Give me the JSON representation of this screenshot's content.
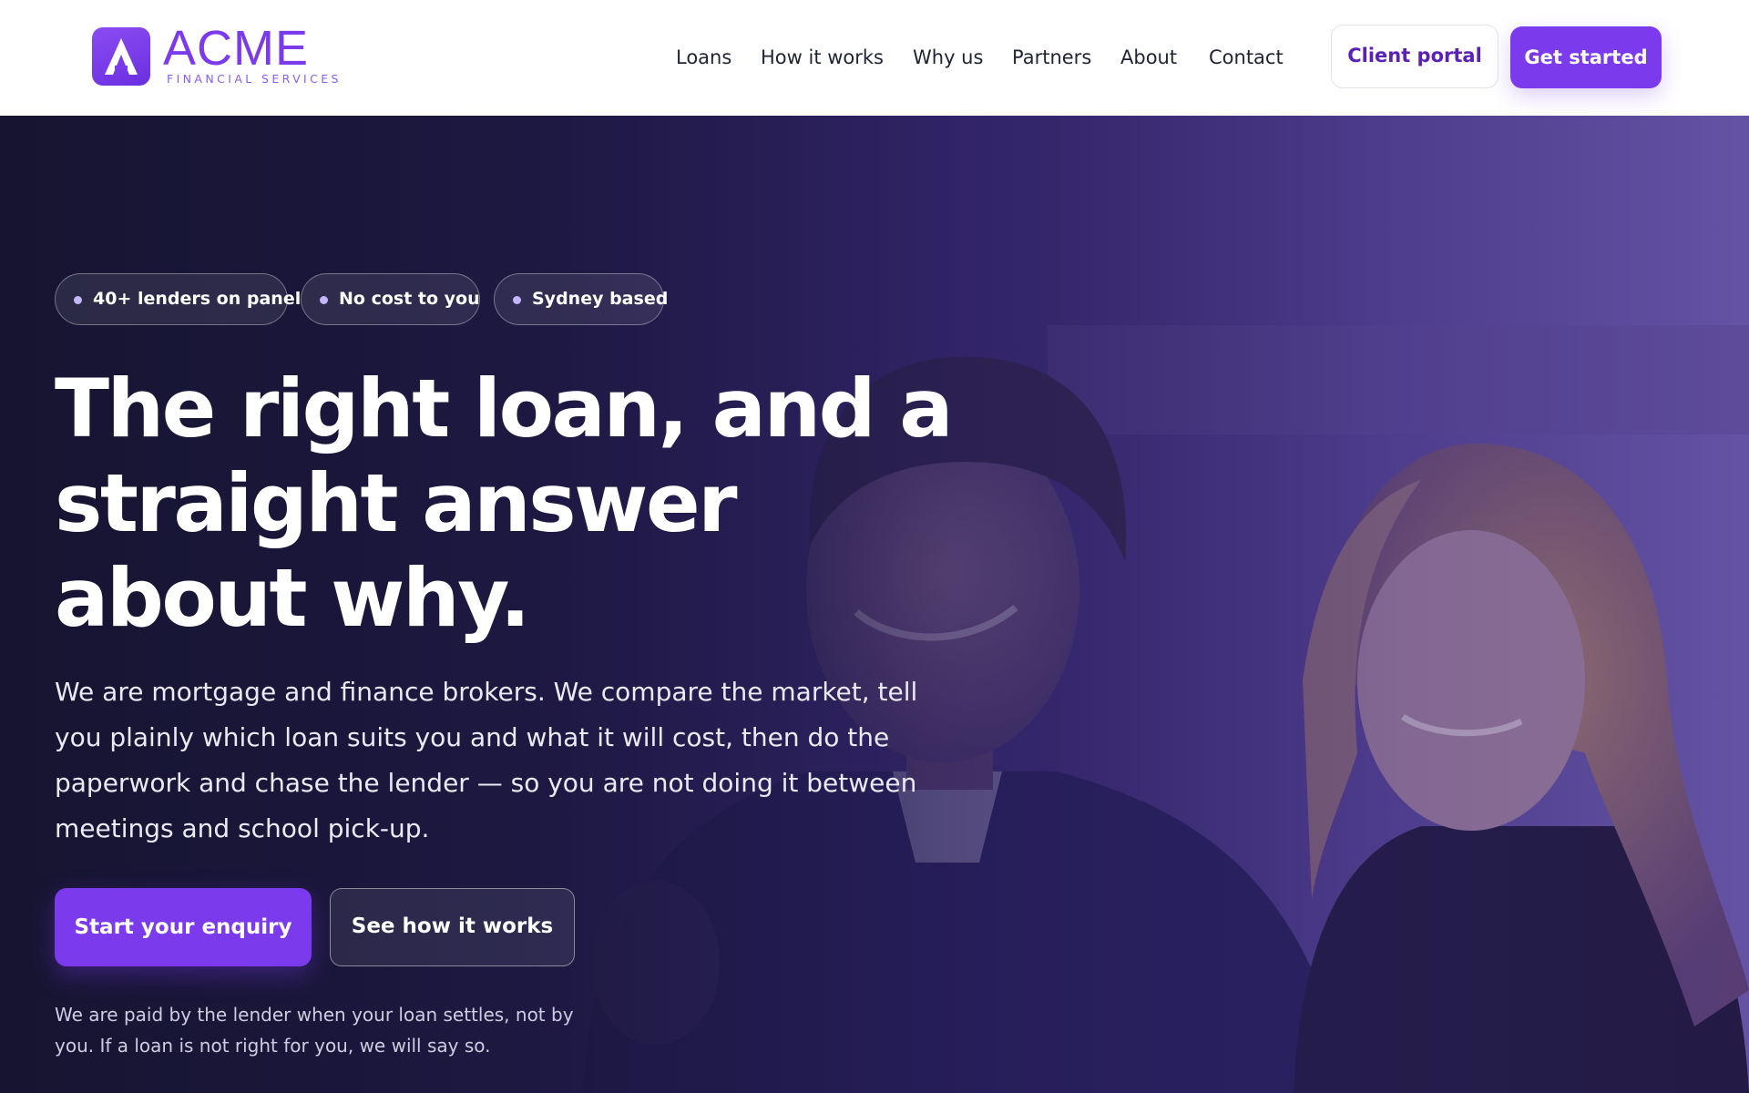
{
  "brand": {
    "name": "ACME",
    "tagline": "FINANCIAL SERVICES",
    "logo_icon": "letter-a-logo-icon"
  },
  "nav": {
    "items": [
      "Loans",
      "How it works",
      "Why us",
      "Partners",
      "About",
      "Contact"
    ],
    "client_portal": "Client portal",
    "get_started": "Get started"
  },
  "hero": {
    "badges": [
      "40+ lenders on panel",
      "No cost to you",
      "Sydney based"
    ],
    "headline": "The right loan, and a straight answer about why.",
    "lead": "We are mortgage and finance brokers. We compare the market, tell you plainly which loan suits you and what it will cost, then do the paperwork and chase the lender — so you are not doing it between meetings and school pick-up.",
    "cta_primary": "Start your enquiry",
    "cta_secondary": "See how it works",
    "disclaimer": "We are paid by the lender when your loan settles, not by you. If a loan is not right for you, we will say so."
  },
  "colors": {
    "accent": "#7c3aed",
    "accent_dark": "#5b21b6",
    "hero_dark": "#1d1a44",
    "nav_text": "#1f2433"
  }
}
